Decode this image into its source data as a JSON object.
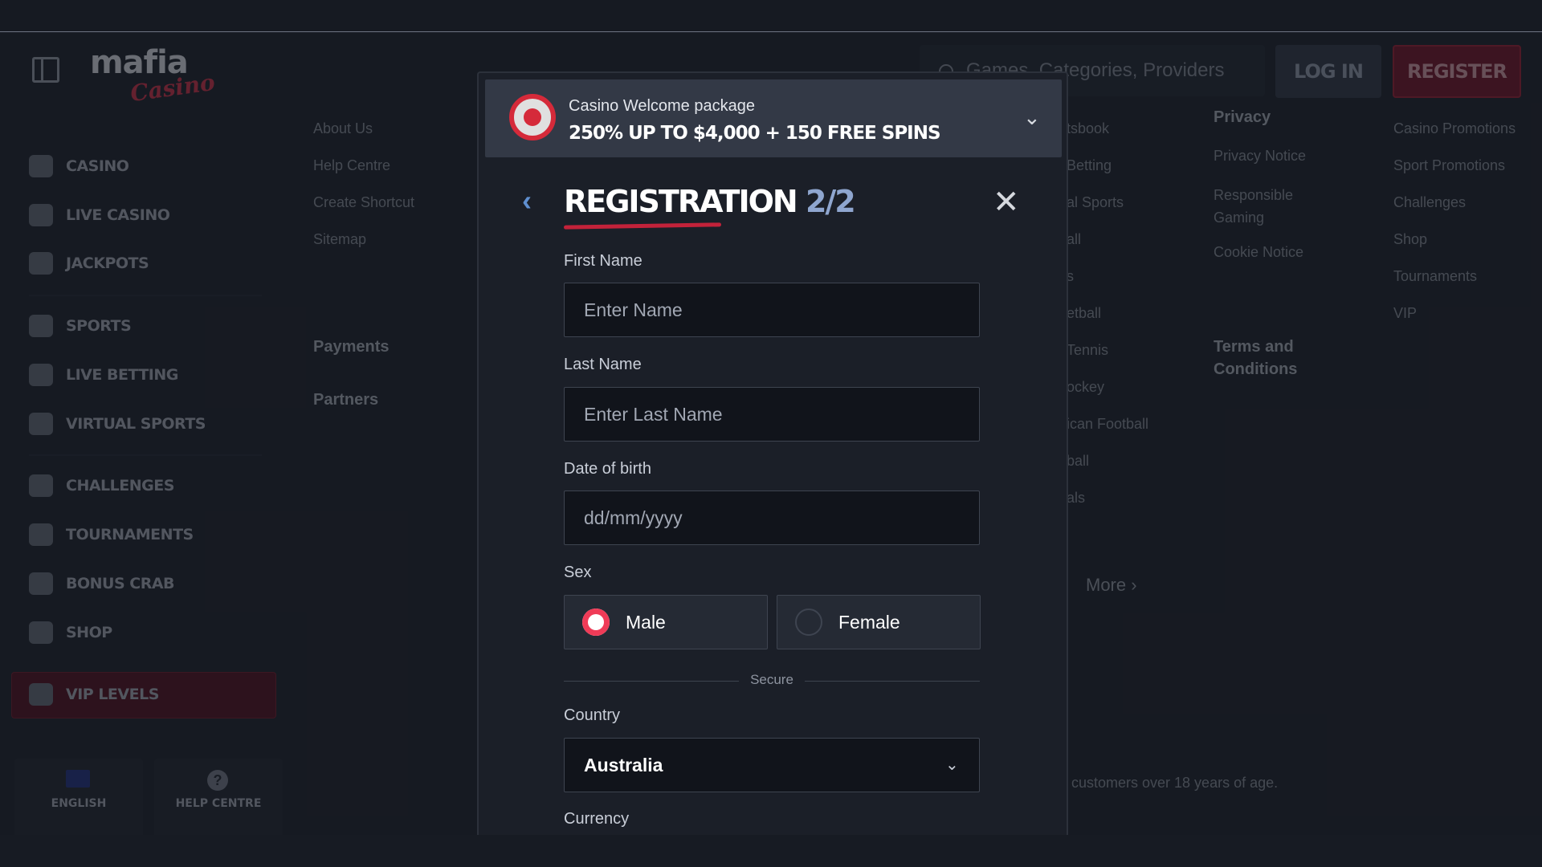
{
  "header": {
    "logo_top": "mafia",
    "logo_bottom": "Casino",
    "search_placeholder": "Games, Categories, Providers",
    "login_label": "LOG IN",
    "register_label": "REGISTER"
  },
  "sidebar": {
    "items": [
      {
        "label": "CASINO",
        "icon": "spade-icon"
      },
      {
        "label": "LIVE CASINO",
        "icon": "live-casino-icon"
      },
      {
        "label": "JACKPOTS",
        "icon": "clover-icon"
      },
      {
        "label": "SPORTS",
        "icon": "soccer-ball-icon"
      },
      {
        "label": "LIVE BETTING",
        "icon": "live-betting-icon"
      },
      {
        "label": "VIRTUAL SPORTS",
        "icon": "virtual-sports-icon"
      },
      {
        "label": "CHALLENGES",
        "icon": "gear-badge-icon"
      },
      {
        "label": "TOURNAMENTS",
        "icon": "trophy-icon"
      },
      {
        "label": "BONUS CRAB",
        "icon": "crab-icon"
      },
      {
        "label": "SHOP",
        "icon": "shop-icon"
      },
      {
        "label": "VIP LEVELS",
        "icon": "diamond-icon"
      }
    ],
    "language_label": "ENGLISH",
    "help_label": "HELP CENTRE"
  },
  "footer_columns": {
    "col1": {
      "links": [
        "About Us",
        "Help Centre",
        "Create Shortcut",
        "Sitemap"
      ],
      "headings": [
        "Payments",
        "Partners"
      ]
    },
    "col2": {
      "links": [
        "tsbook",
        "Betting",
        "al Sports",
        "all",
        "s",
        "etball",
        "Tennis",
        "ockey",
        "ican Football",
        "ball",
        "als"
      ],
      "more": "More"
    },
    "col3": {
      "heading1": "Privacy",
      "links": [
        "Privacy Notice",
        "Responsible Gaming",
        "Cookie Notice"
      ],
      "heading2": "Terms and Conditions"
    },
    "col4": {
      "links": [
        "Casino Promotions",
        "Sport Promotions",
        "Challenges",
        "Shop",
        "Tournaments",
        "VIP"
      ]
    },
    "footnote": "customers over 18 years of age."
  },
  "modal": {
    "promo_title": "Casino Welcome package",
    "promo_offer": "250% UP TO $4,000 + 150 FREE SPINS",
    "title": "REGISTRATION ",
    "step": "2/2",
    "first_name_label": "First Name",
    "first_name_placeholder": "Enter Name",
    "last_name_label": "Last Name",
    "last_name_placeholder": "Enter Last Name",
    "dob_label": "Date of birth",
    "dob_placeholder": "dd/mm/yyyy",
    "sex_label": "Sex",
    "sex_options": [
      "Male",
      "Female"
    ],
    "sex_selected": "Male",
    "secure_label": "Secure",
    "country_label": "Country",
    "country_value": "Australia",
    "currency_label": "Currency"
  },
  "colors": {
    "accent": "#ef3b57",
    "register_bg": "#7a1d34",
    "modal_bg": "#1b1f28"
  }
}
